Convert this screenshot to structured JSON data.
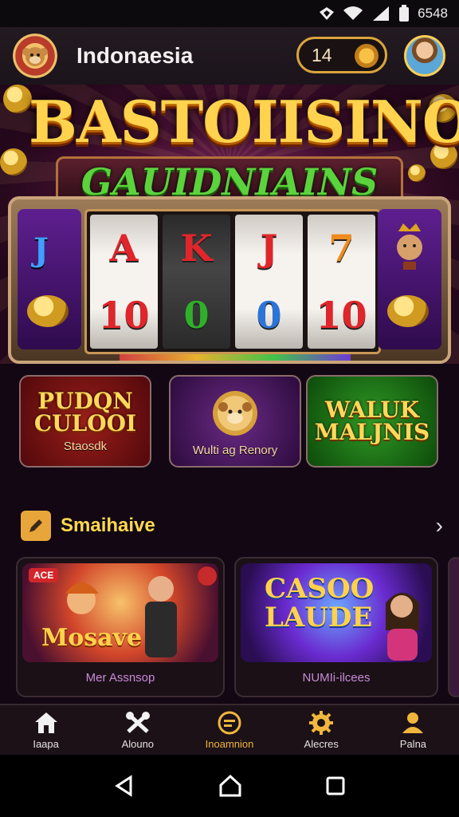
{
  "status_bar": {
    "time": "6548",
    "icons": [
      "vpn-icon",
      "wifi-icon",
      "signal-icon",
      "battery-icon"
    ]
  },
  "app_bar": {
    "region": "Indonaesia",
    "coin_count": "14"
  },
  "hero": {
    "title_line1": "BASTOIISINO",
    "title_line2": "GAUIDNIAINS"
  },
  "reels": [
    {
      "top": "A",
      "bottom": "10"
    },
    {
      "top": "K",
      "bottom": "0"
    },
    {
      "top": "J",
      "bottom": "0"
    },
    {
      "top": "7",
      "bottom": "10"
    }
  ],
  "side_symbol": "J",
  "categories": [
    {
      "title": "PUDQN CULOOI",
      "subtitle": "Staosdk"
    },
    {
      "title": "",
      "subtitle": "Wulti ag Renory"
    },
    {
      "title": "WALUK MALJNIS",
      "subtitle": ""
    }
  ],
  "section": {
    "title": "Smaihaive"
  },
  "games": [
    {
      "art_title": "Mosave",
      "badge": "ACE",
      "label": "Mer Assnsop"
    },
    {
      "art_title": "CASOO LAUDE",
      "label": "NUMIi-ilcees"
    }
  ],
  "nav": [
    {
      "label": "Iaapa",
      "icon": "home-icon"
    },
    {
      "label": "Alouno",
      "icon": "tools-icon"
    },
    {
      "label": "Inoamnion",
      "icon": "chat-icon"
    },
    {
      "label": "Alecres",
      "icon": "gear-icon"
    },
    {
      "label": "Palna",
      "icon": "profile-icon"
    }
  ],
  "colors": {
    "accent_gold": "#ffd84f",
    "background": "#120713",
    "nav_active": "#f0b63d"
  }
}
